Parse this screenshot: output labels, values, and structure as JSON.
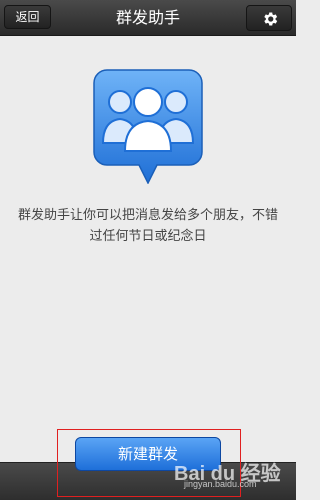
{
  "header": {
    "back_label": "返回",
    "title": "群发助手",
    "settings_icon": "gear-icon"
  },
  "main": {
    "icon": "group-contacts-bubble-icon",
    "description": "群发助手让你可以把消息发给多个朋友，不错过任何节日或纪念日"
  },
  "footer": {
    "button_label": "新建群发"
  },
  "watermark": {
    "logo_text": "Bai du 经验",
    "url_text": "jingyan.baidu.com"
  },
  "colors": {
    "accent": "#1e6fd9",
    "header_bg": "#333333",
    "background": "#ececec"
  }
}
